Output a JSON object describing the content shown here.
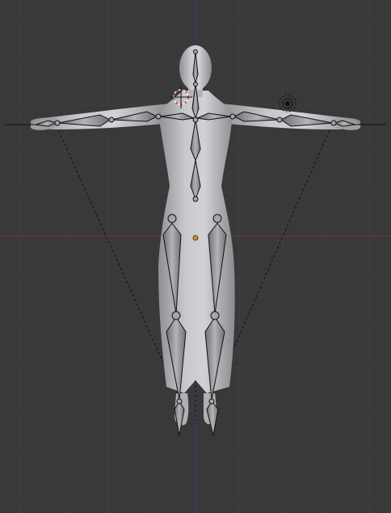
{
  "viewport": {
    "background": "#393939",
    "grid_color": "#404040",
    "axis_x_color": "#7a3a3a",
    "axis_y_color": "#3a3a8a",
    "mesh_color": "#b9b9bd",
    "bone_color": "#8c8c90",
    "bone_outline": "#111111",
    "origin_color": "#e08a2a",
    "cursor_color": "#cc3333"
  },
  "icons": {
    "cursor": "3d-cursor-icon",
    "lamp": "lamp-icon",
    "origin": "object-origin-icon"
  }
}
